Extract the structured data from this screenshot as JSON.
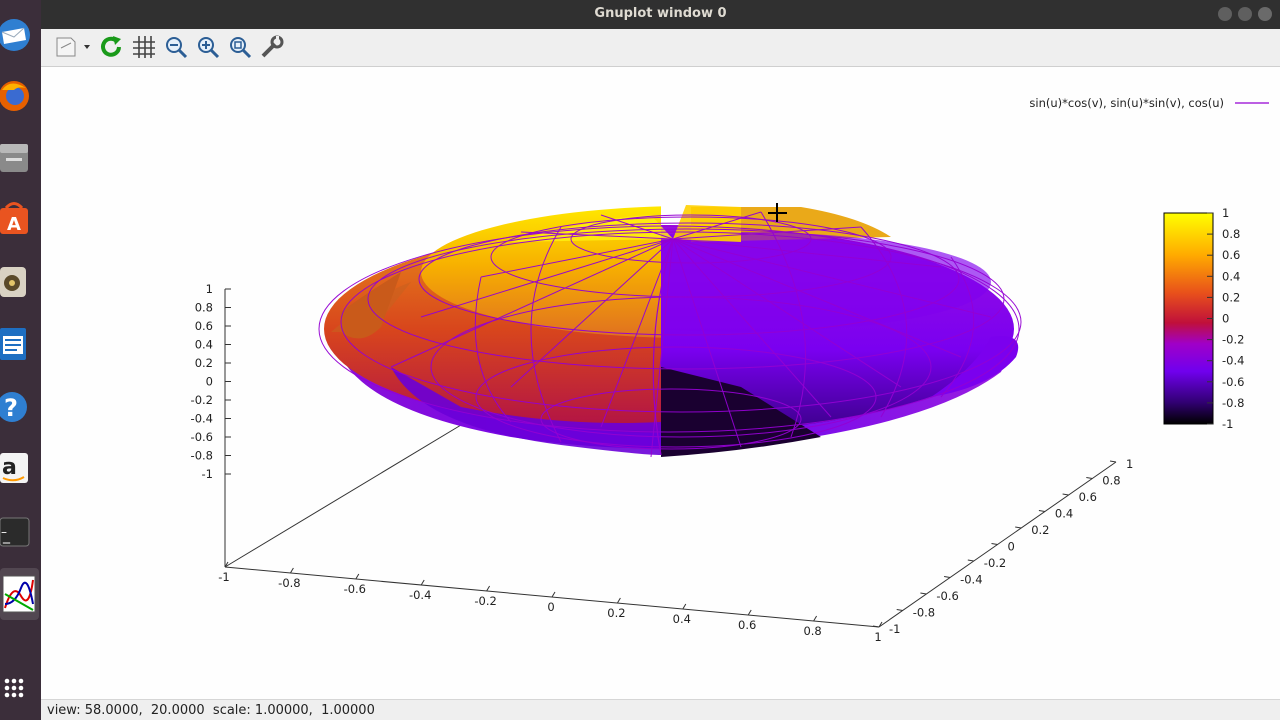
{
  "window": {
    "title": "Gnuplot window 0"
  },
  "toolbar": {
    "items": [
      {
        "name": "export-menu-button",
        "icon": "export-icon"
      },
      {
        "name": "replot-button",
        "icon": "refresh-icon"
      },
      {
        "name": "grid-button",
        "icon": "grid-icon"
      },
      {
        "name": "zoom-previous-button",
        "icon": "zoom-out-icon"
      },
      {
        "name": "zoom-next-button",
        "icon": "zoom-in-icon"
      },
      {
        "name": "autoscale-button",
        "icon": "zoom-fit-icon"
      },
      {
        "name": "settings-button",
        "icon": "wrench-icon"
      }
    ]
  },
  "plot": {
    "legend": "sin(u)*cos(v), sin(u)*sin(v), cos(u)",
    "z_ticks": [
      "1",
      "0.8",
      "0.6",
      "0.4",
      "0.2",
      "0",
      "-0.2",
      "-0.4",
      "-0.6",
      "-0.8",
      "-1"
    ],
    "x_ticks": [
      "-1",
      "-0.8",
      "-0.6",
      "-0.4",
      "-0.2",
      "0",
      "0.2",
      "0.4",
      "0.6",
      "0.8",
      "1"
    ],
    "y_ticks": [
      "-1",
      "-0.8",
      "-0.6",
      "-0.4",
      "-0.2",
      "0",
      "0.2",
      "0.4",
      "0.6",
      "0.8",
      "1"
    ],
    "cb_ticks": [
      "1",
      "0.8",
      "0.6",
      "0.4",
      "0.2",
      "0",
      "-0.2",
      "-0.4",
      "-0.6",
      "-0.8",
      "-1"
    ],
    "colors": {
      "line": "#9400d3"
    }
  },
  "chart_data": {
    "type": "surface",
    "function": "sin(u)*cos(v), sin(u)*sin(v), cos(u)",
    "xlim": [
      -1,
      1
    ],
    "ylim": [
      -1,
      1
    ],
    "zlim": [
      -1,
      1
    ],
    "cblim": [
      -1,
      1
    ],
    "palette": "black-blue-purple-red-orange-yellow",
    "legend_position": "top-right"
  },
  "statusbar": {
    "text": "view: 58.0000,  20.0000  scale: 1.00000,  1.00000"
  },
  "dock": {
    "items": [
      {
        "name": "dock-mail",
        "icon": "mail-icon"
      },
      {
        "name": "dock-firefox",
        "icon": "firefox-icon"
      },
      {
        "name": "dock-files",
        "icon": "files-icon"
      },
      {
        "name": "dock-software",
        "icon": "software-center-icon"
      },
      {
        "name": "dock-rhythmbox",
        "icon": "speaker-icon"
      },
      {
        "name": "dock-writer",
        "icon": "document-icon"
      },
      {
        "name": "dock-help",
        "icon": "help-icon"
      },
      {
        "name": "dock-amazon",
        "icon": "amazon-icon"
      },
      {
        "name": "dock-terminal",
        "icon": "terminal-icon"
      },
      {
        "name": "dock-gnuplot",
        "icon": "gnuplot-icon"
      },
      {
        "name": "dock-apps",
        "icon": "apps-grid-icon"
      }
    ]
  }
}
